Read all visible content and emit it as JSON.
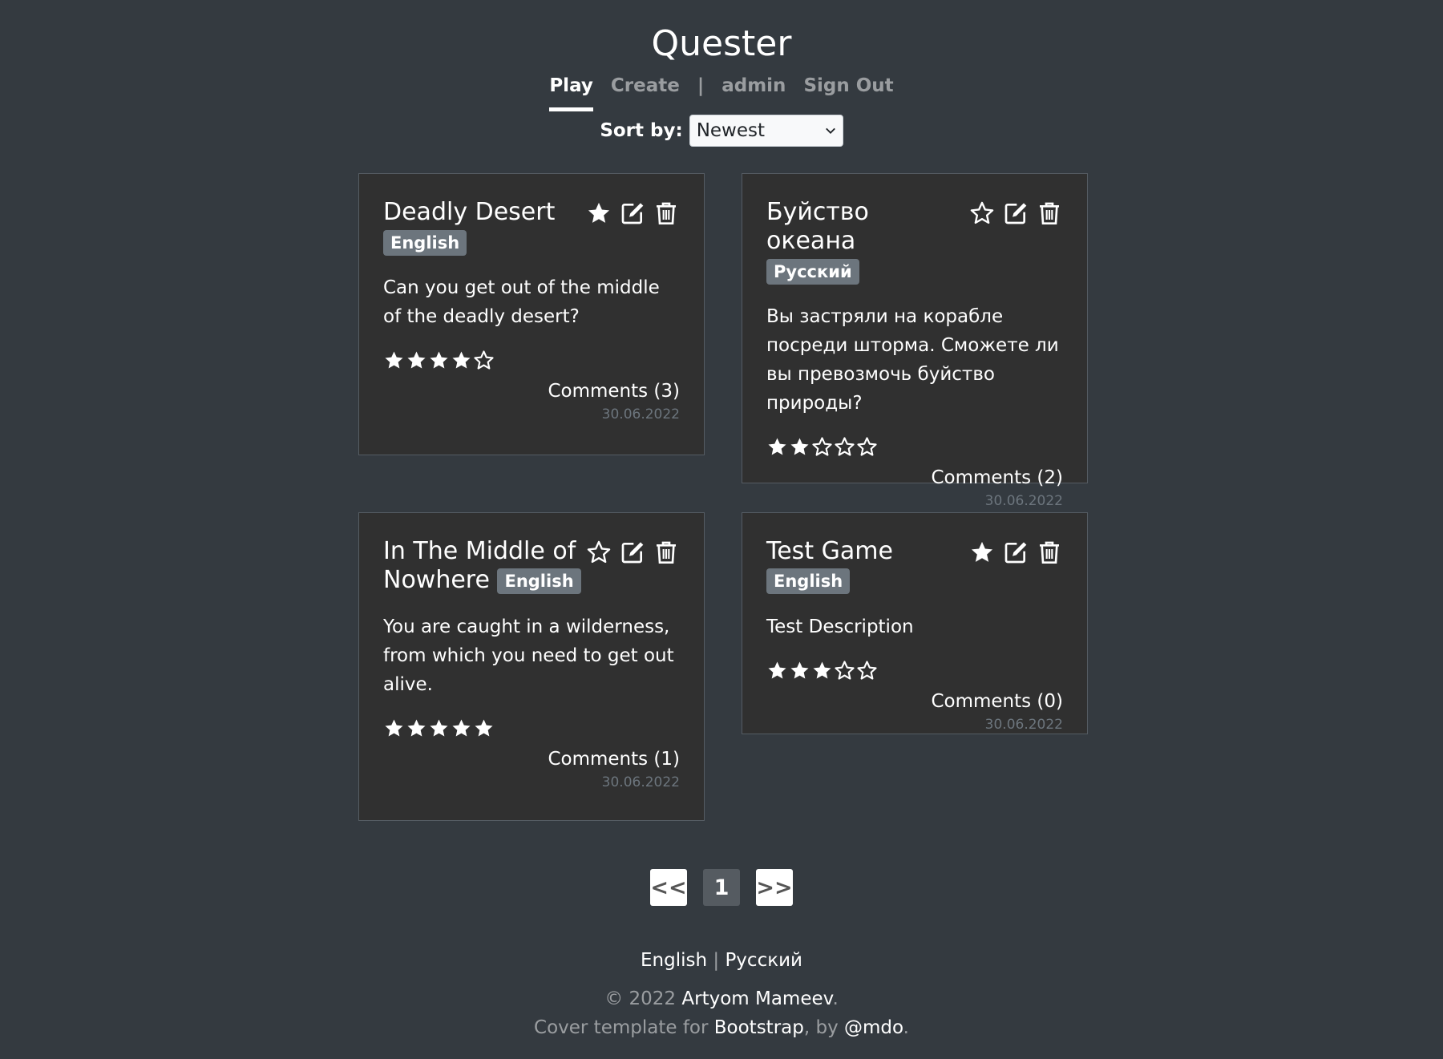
{
  "brand": "Quester",
  "nav": {
    "play": "Play",
    "create": "Create",
    "separator": "|",
    "user": "admin",
    "sign_out": "Sign Out"
  },
  "sort": {
    "label": "Sort by:",
    "selected": "Newest"
  },
  "cards": [
    {
      "title": "Deadly Desert",
      "language": "English",
      "favorited": true,
      "description": "Can you get out of the middle of the deadly desert?",
      "rating": 4,
      "comments": "Comments (3)",
      "date": "30.06.2022"
    },
    {
      "title": "Буйство океана",
      "language": "Русский",
      "favorited": false,
      "description": "Вы застряли на корабле посреди шторма. Сможете ли вы превозмочь буйство природы?",
      "rating": 2,
      "comments": "Comments (2)",
      "date": "30.06.2022"
    },
    {
      "title": "In The Middle of Nowhere",
      "language": "English",
      "favorited": false,
      "description": "You are caught in a wilderness, from which you need to get out alive.",
      "rating": 5,
      "comments": "Comments (1)",
      "date": "30.06.2022"
    },
    {
      "title": "Test Game",
      "language": "English",
      "favorited": true,
      "description": "Test Description",
      "rating": 3,
      "comments": "Comments (0)",
      "date": "30.06.2022"
    }
  ],
  "pagination": {
    "prev": "<<",
    "current": "1",
    "next": ">>"
  },
  "footer": {
    "lang_en": "English",
    "lang_sep": "|",
    "lang_ru": "Русский",
    "copyright": "© 2022",
    "author": "Artyom Mameev",
    "period": ".",
    "template_text": "Cover template for",
    "bootstrap": "Bootstrap",
    "by": ", by",
    "mdo": "@mdo",
    "end": "."
  },
  "colors": {
    "background": "#343a40",
    "card": "#303030",
    "badge": "#6c757d"
  }
}
